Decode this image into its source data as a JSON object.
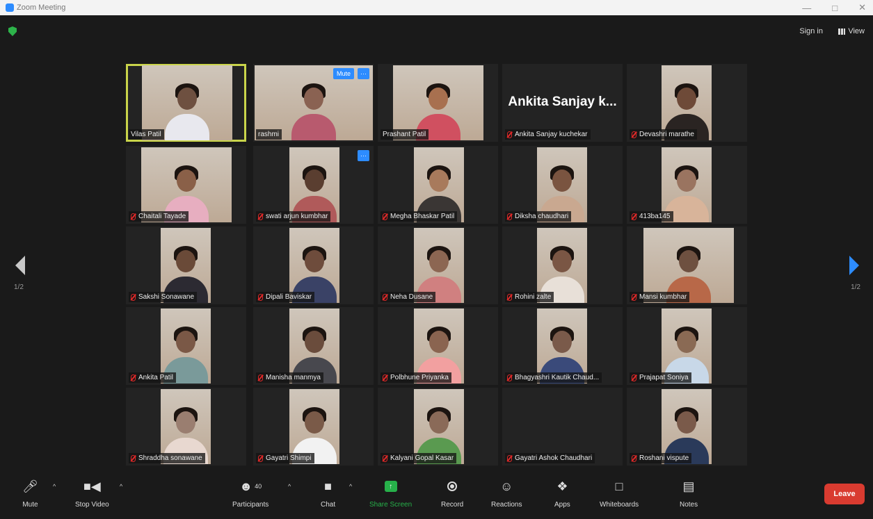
{
  "window": {
    "title": "Zoom Meeting"
  },
  "header": {
    "sign_in": "Sign in",
    "view": "View"
  },
  "pagination": {
    "left_label": "1/2",
    "right_label": "1/2"
  },
  "tile_controls": {
    "mute": "Mute",
    "more": "···"
  },
  "participants": [
    {
      "name": "Vilas Patil"
    },
    {
      "name": "rashmi"
    },
    {
      "name": "Prashant Patil"
    },
    {
      "name": "Ankita Sanjay kuchekar",
      "display": "Ankita Sanjay k..."
    },
    {
      "name": "Devashri marathe"
    },
    {
      "name": "Chaitali Tayade"
    },
    {
      "name": "swati arjun kumbhar"
    },
    {
      "name": "Megha Bhaskar Patil"
    },
    {
      "name": "Diksha chaudhari"
    },
    {
      "name": "413ba145"
    },
    {
      "name": "Sakshi Sonawane"
    },
    {
      "name": "Dipali Baviskar"
    },
    {
      "name": "Neha Dusane"
    },
    {
      "name": "Rohini zalte"
    },
    {
      "name": "Mansi kumbhar"
    },
    {
      "name": "Ankita Patil"
    },
    {
      "name": "Manisha manmya"
    },
    {
      "name": "Polbhune Priyanka"
    },
    {
      "name": "Bhagyashri Kautik Chaud..."
    },
    {
      "name": "Prajapat Soniya"
    },
    {
      "name": "Shraddha sonawane"
    },
    {
      "name": "Gayatri Shimpi"
    },
    {
      "name": "Kalyani Gopal Kasar"
    },
    {
      "name": "Gayatri Ashok Chaudhari"
    },
    {
      "name": "Roshani vispute"
    }
  ],
  "toolbar": {
    "mute": "Mute",
    "stop_video": "Stop Video",
    "participants": "Participants",
    "participants_count": "40",
    "chat": "Chat",
    "share_screen": "Share Screen",
    "record": "Record",
    "reactions": "Reactions",
    "apps": "Apps",
    "whiteboards": "Whiteboards",
    "notes": "Notes",
    "leave": "Leave"
  },
  "colors": {
    "active_speaker": "#c9d44a",
    "accent": "#2d8cff",
    "share": "#27b14a",
    "leave": "#d93b30",
    "muted": "#e02828"
  }
}
